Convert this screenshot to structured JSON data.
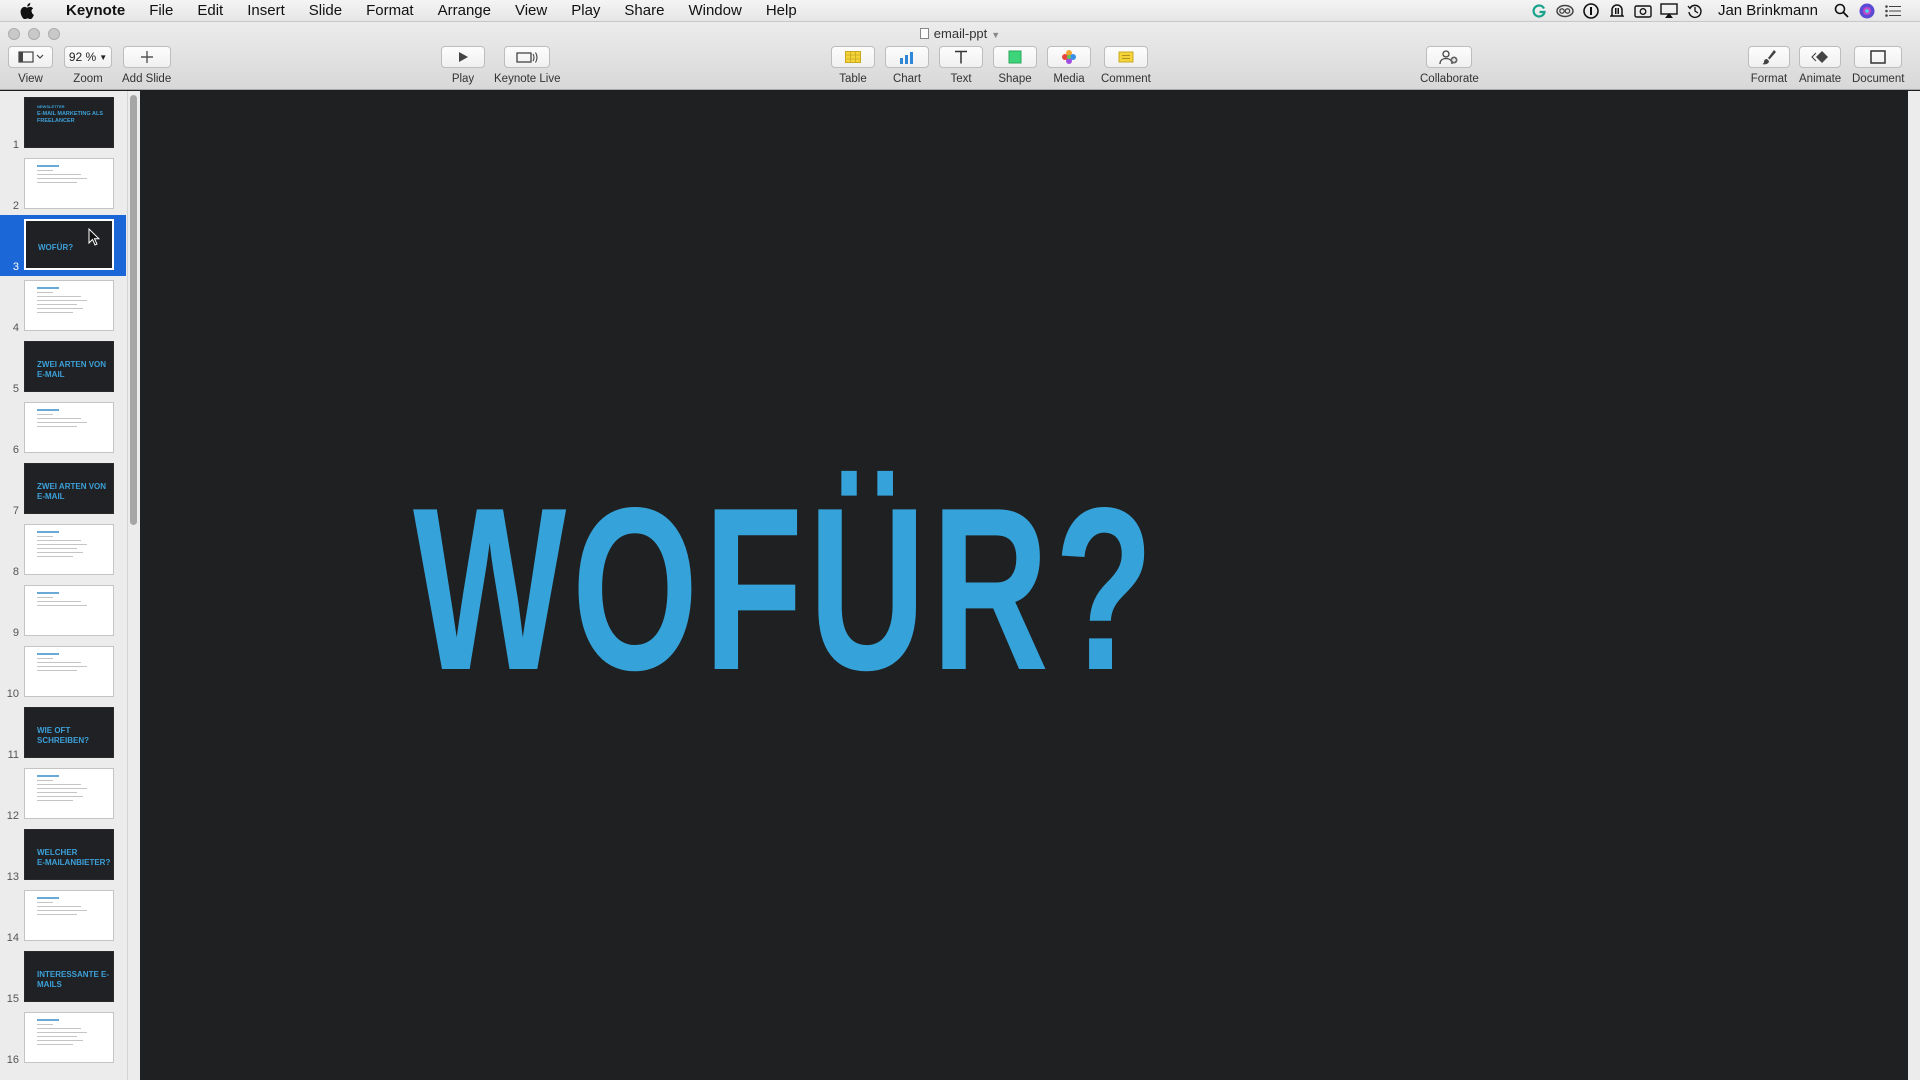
{
  "menubar": {
    "app_name": "Keynote",
    "items": [
      "File",
      "Edit",
      "Insert",
      "Slide",
      "Format",
      "Arrange",
      "View",
      "Play",
      "Share",
      "Window",
      "Help"
    ],
    "user_name": "Jan Brinkmann"
  },
  "window": {
    "document_title": "email-ppt"
  },
  "toolbar": {
    "view_label": "View",
    "zoom_value": "92 %",
    "zoom_label": "Zoom",
    "add_slide_label": "Add Slide",
    "play_label": "Play",
    "keynote_live_label": "Keynote Live",
    "table_label": "Table",
    "chart_label": "Chart",
    "text_label": "Text",
    "shape_label": "Shape",
    "media_label": "Media",
    "comment_label": "Comment",
    "collaborate_label": "Collaborate",
    "format_label": "Format",
    "animate_label": "Animate",
    "document_label": "Document"
  },
  "navigator": {
    "selected_slide": 3,
    "slides": [
      {
        "num": "1",
        "dark": true,
        "title": "E-MAIL MARKETING ALS\nFREELANCER",
        "kicker": "NEWSLETTER"
      },
      {
        "num": "2",
        "dark": false,
        "title": ""
      },
      {
        "num": "3",
        "dark": true,
        "title": "WOFÜR?"
      },
      {
        "num": "4",
        "dark": false,
        "title": ""
      },
      {
        "num": "5",
        "dark": true,
        "title": "ZWEI ARTEN VON\nE-MAIL"
      },
      {
        "num": "6",
        "dark": false,
        "title": ""
      },
      {
        "num": "7",
        "dark": true,
        "title": "ZWEI ARTEN VON\nE-MAIL"
      },
      {
        "num": "8",
        "dark": false,
        "title": ""
      },
      {
        "num": "9",
        "dark": false,
        "title": ""
      },
      {
        "num": "10",
        "dark": false,
        "title": ""
      },
      {
        "num": "11",
        "dark": true,
        "title": "WIE OFT\nSCHREIBEN?"
      },
      {
        "num": "12",
        "dark": false,
        "title": ""
      },
      {
        "num": "13",
        "dark": true,
        "title": "WELCHER\nE-MAILANBIETER?"
      },
      {
        "num": "14",
        "dark": false,
        "title": ""
      },
      {
        "num": "15",
        "dark": true,
        "title": "INTERESSANTE E-\nMAILS"
      },
      {
        "num": "16",
        "dark": false,
        "title": ""
      }
    ]
  },
  "slide": {
    "title": "WOFÜR?"
  },
  "colors": {
    "accent_blue": "#35a3d9",
    "selection_blue": "#1c67d8",
    "slide_background": "#1f2022"
  }
}
